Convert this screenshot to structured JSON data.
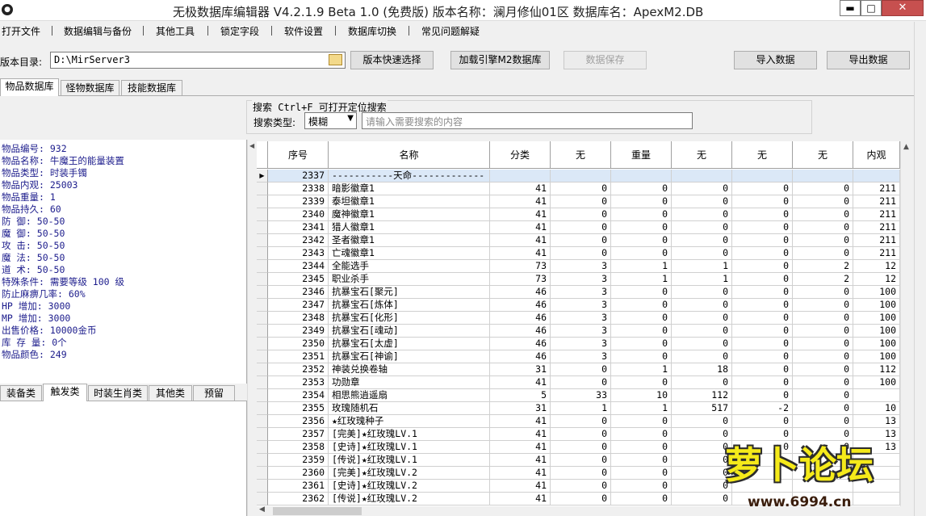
{
  "window": {
    "title": "无极数据库编辑器 V4.2.1.9    Beta 1.0 (免费版)     版本名称：澜月修仙01区      数据库名：ApexM2.DB",
    "min_glyph": "▬",
    "max_glyph": "□",
    "close_glyph": "✕"
  },
  "menu": [
    "打开文件",
    "数据编辑与备份",
    "其他工具",
    "锁定字段",
    "软件设置",
    "数据库切换",
    "常见问题解疑"
  ],
  "toolbar": {
    "dir_label": "版本目录:",
    "dir_value": "D:\\MirServer3",
    "quick_select": "版本快速选择",
    "load_m2": "加载引擎M2数据库",
    "save_data": "数据保存",
    "import_data": "导入数据",
    "export_data": "导出数据"
  },
  "tabs": [
    "物品数据库",
    "怪物数据库",
    "技能数据库"
  ],
  "search": {
    "caption": "搜索  Ctrl+F 可打开定位搜索",
    "type_label": "搜索类型:",
    "type_value": "模糊",
    "placeholder": "请输入需要搜索的内容"
  },
  "item_info": [
    "物品编号: 932",
    "物品名称: 牛魔王的能量装置",
    "物品类型: 时装手镯",
    "物品内观: 25003",
    "物品重量: 1",
    "物品持久: 60",
    "防    御: 50-50",
    "魔    御: 50-50",
    "攻    击: 50-50",
    "魔    法: 50-50",
    "道    术: 50-50",
    "特殊条件: 需要等级 100 级",
    "防止麻痹几率: 60%",
    "HP  增加: 3000",
    "MP  增加: 3000",
    "出售价格: 10000金币",
    "库 存 量: 0个",
    "物品颜色: 249"
  ],
  "bottom_tabs": [
    "装备类",
    "触发类",
    "时装生肖类",
    "其他类",
    "预留"
  ],
  "grid": {
    "columns": [
      "序号",
      "名称",
      "分类",
      "无",
      "重量",
      "无",
      "无",
      "无",
      "内观"
    ],
    "rows": [
      [
        "2337",
        "-----------天命-------------",
        "",
        "",
        "",
        "",
        "",
        "",
        ""
      ],
      [
        "2338",
        "暗影徽章1",
        "41",
        "0",
        "0",
        "0",
        "0",
        "0",
        "211"
      ],
      [
        "2339",
        "泰坦徽章1",
        "41",
        "0",
        "0",
        "0",
        "0",
        "0",
        "211"
      ],
      [
        "2340",
        "魔神徽章1",
        "41",
        "0",
        "0",
        "0",
        "0",
        "0",
        "211"
      ],
      [
        "2341",
        "猎人徽章1",
        "41",
        "0",
        "0",
        "0",
        "0",
        "0",
        "211"
      ],
      [
        "2342",
        "圣者徽章1",
        "41",
        "0",
        "0",
        "0",
        "0",
        "0",
        "211"
      ],
      [
        "2343",
        "亡魂徽章1",
        "41",
        "0",
        "0",
        "0",
        "0",
        "0",
        "211"
      ],
      [
        "2344",
        "全能选手",
        "73",
        "3",
        "1",
        "1",
        "0",
        "2",
        "12"
      ],
      [
        "2345",
        "职业杀手",
        "73",
        "3",
        "1",
        "1",
        "0",
        "2",
        "12"
      ],
      [
        "2346",
        "抗暴宝石[聚元]",
        "46",
        "3",
        "0",
        "0",
        "0",
        "0",
        "100"
      ],
      [
        "2347",
        "抗暴宝石[炼体]",
        "46",
        "3",
        "0",
        "0",
        "0",
        "0",
        "100"
      ],
      [
        "2348",
        "抗暴宝石[化形]",
        "46",
        "3",
        "0",
        "0",
        "0",
        "0",
        "100"
      ],
      [
        "2349",
        "抗暴宝石[魂动]",
        "46",
        "3",
        "0",
        "0",
        "0",
        "0",
        "100"
      ],
      [
        "2350",
        "抗暴宝石[太虚]",
        "46",
        "3",
        "0",
        "0",
        "0",
        "0",
        "100"
      ],
      [
        "2351",
        "抗暴宝石[神谕]",
        "46",
        "3",
        "0",
        "0",
        "0",
        "0",
        "100"
      ],
      [
        "2352",
        "神装兑换卷轴",
        "31",
        "0",
        "1",
        "18",
        "0",
        "0",
        "112"
      ],
      [
        "2353",
        "功勋章",
        "41",
        "0",
        "0",
        "0",
        "0",
        "0",
        "100"
      ],
      [
        "2354",
        "相思熊逍遥扇",
        "5",
        "33",
        "10",
        "112",
        "0",
        "0",
        ""
      ],
      [
        "2355",
        "玫瑰随机石",
        "31",
        "1",
        "1",
        "517",
        "-2",
        "0",
        "10"
      ],
      [
        "2356",
        "★红玫瑰种子",
        "41",
        "0",
        "0",
        "0",
        "0",
        "0",
        "13"
      ],
      [
        "2357",
        "[完美]★红玫瑰LV.1",
        "41",
        "0",
        "0",
        "0",
        "0",
        "0",
        "13"
      ],
      [
        "2358",
        "[史诗]★红玫瑰LV.1",
        "41",
        "0",
        "0",
        "0",
        "0",
        "0",
        "13"
      ],
      [
        "2359",
        "[传说]★红玫瑰LV.1",
        "41",
        "0",
        "0",
        "0",
        "",
        "",
        ""
      ],
      [
        "2360",
        "[完美]★红玫瑰LV.2",
        "41",
        "0",
        "0",
        "0",
        "",
        "",
        ""
      ],
      [
        "2361",
        "[史诗]★红玫瑰LV.2",
        "41",
        "0",
        "0",
        "0",
        "",
        "",
        ""
      ],
      [
        "2362",
        "[传说]★红玫瑰LV.2",
        "41",
        "0",
        "0",
        "0",
        "",
        "",
        ""
      ]
    ]
  },
  "watermark": {
    "logo_text": "萝卜论坛",
    "url": "www.6994.cn"
  },
  "colors": {
    "info_text": "#1c1c8c",
    "selected_row": "#dbe8f7",
    "close_button": "#c7504f"
  }
}
